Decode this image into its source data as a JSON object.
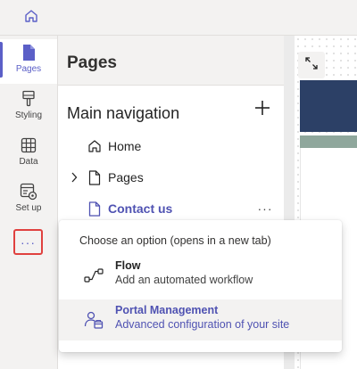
{
  "colors": {
    "accent": "#5b5fc7",
    "accent_dark": "#4f52b2",
    "highlight_border": "#e0413f",
    "banner": "#2c4066",
    "stripe": "#8fa79c"
  },
  "topbar": {
    "home_icon": "home-icon"
  },
  "rail": {
    "items": [
      {
        "label": "Pages",
        "icon": "page-icon",
        "active": true
      },
      {
        "label": "Styling",
        "icon": "brush-icon",
        "active": false
      },
      {
        "label": "Data",
        "icon": "table-icon",
        "active": false
      },
      {
        "label": "Set up",
        "icon": "settings-window-icon",
        "active": false
      }
    ],
    "more": {
      "label": "···",
      "icon": "more-horizontal-icon"
    }
  },
  "panel": {
    "title": "Pages",
    "navigation": {
      "title": "Main navigation",
      "add_icon": "add-icon",
      "items": [
        {
          "label": "Home",
          "icon": "home-icon",
          "expandable": false,
          "selected": false
        },
        {
          "label": "Pages",
          "icon": "page-icon",
          "expandable": true,
          "selected": false
        },
        {
          "label": "Contact us",
          "icon": "page-icon",
          "expandable": false,
          "selected": true,
          "more": "···"
        }
      ]
    }
  },
  "canvas": {
    "expand_icon": "expand-icon"
  },
  "popup": {
    "header": "Choose an option (opens in a new tab)",
    "options": [
      {
        "title": "Flow",
        "subtitle": "Add an automated workflow",
        "icon": "flow-icon",
        "highlighted": false
      },
      {
        "title": "Portal Management",
        "subtitle": "Advanced configuration of your site",
        "icon": "portal-management-icon",
        "highlighted": true
      }
    ]
  }
}
